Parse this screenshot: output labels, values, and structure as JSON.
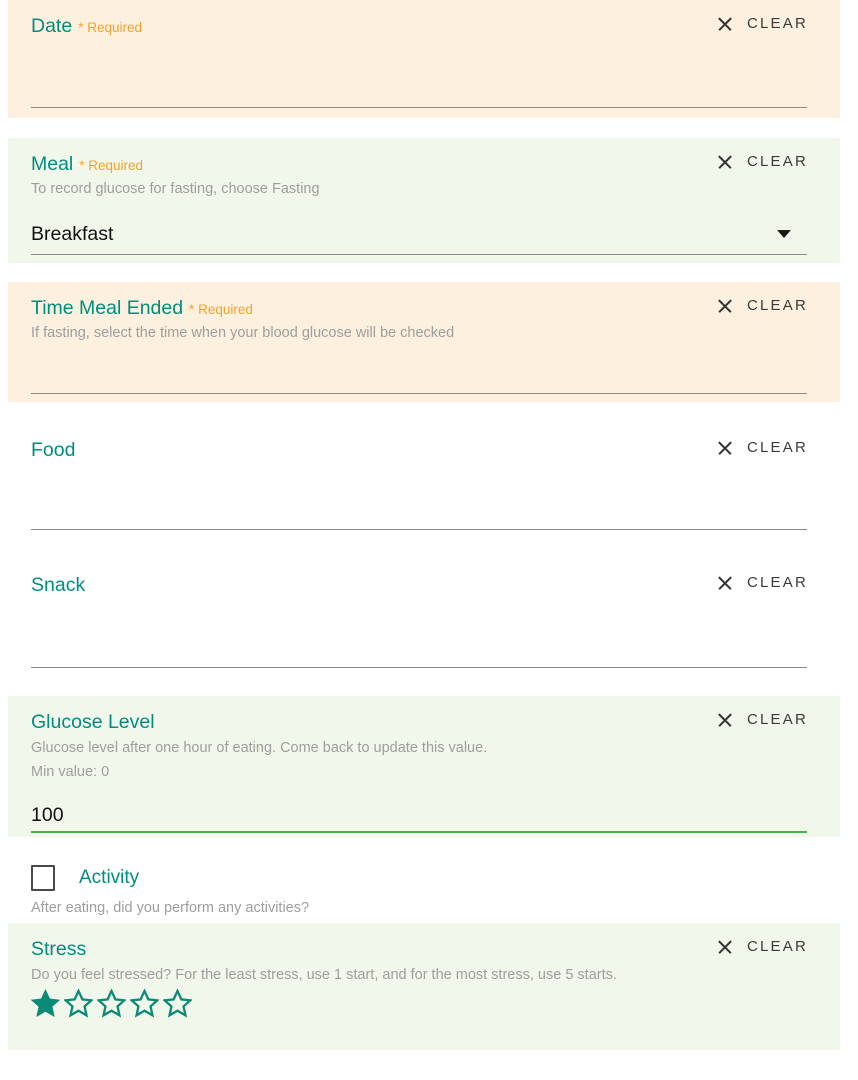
{
  "theme": {
    "label_color": "#008d7f",
    "required_color": "#f0a330",
    "hint_color": "#9e9e9e",
    "bg_orange": "#fdf0de",
    "bg_green": "#f1f7ea",
    "bg_white": "#ffffff",
    "underline_color": "#8a8a8a",
    "underline_valid_color": "#4cae50",
    "value_color": "#111111",
    "star_color": "#0c8a78"
  },
  "common": {
    "clear_label": "CLEAR",
    "clear_icon": "close-icon",
    "required_label": "* Required"
  },
  "fields": [
    {
      "key": "date",
      "label": "Date",
      "required": true,
      "required_label": "* Required",
      "hint": "",
      "value": "",
      "background": "orange",
      "clear_label": "CLEAR",
      "control": "text"
    },
    {
      "key": "meal",
      "label": "Meal",
      "required": true,
      "required_label": "* Required",
      "hint": "To record glucose for fasting, choose Fasting",
      "value": "Breakfast",
      "background": "green",
      "clear_label": "CLEAR",
      "control": "select",
      "caret_icon": "chevron-down-icon"
    },
    {
      "key": "time-meal-ended",
      "label": "Time Meal Ended",
      "required": true,
      "required_label": "* Required",
      "hint": "If fasting, select the time when your blood glucose will be checked",
      "value": "",
      "background": "orange",
      "clear_label": "CLEAR",
      "control": "text"
    },
    {
      "key": "food",
      "label": "Food",
      "required": false,
      "required_label": "",
      "hint": "",
      "value": "",
      "background": "white",
      "clear_label": "CLEAR",
      "control": "text"
    },
    {
      "key": "snack",
      "label": "Snack",
      "required": false,
      "required_label": "",
      "hint": "",
      "value": "",
      "background": "white",
      "clear_label": "CLEAR",
      "control": "text"
    },
    {
      "key": "glucose-level",
      "label": "Glucose Level",
      "required": false,
      "required_label": "",
      "hint": "Glucose level after one hour of eating. Come back to update this value.",
      "hint2": "Min value: 0",
      "value": "100",
      "background": "green",
      "clear_label": "CLEAR",
      "control": "number",
      "underline_state": "valid"
    },
    {
      "key": "activity",
      "label": "Activity",
      "required": false,
      "required_label": "",
      "hint": "After eating, did you perform any activities?",
      "value": "",
      "background": "white",
      "control": "checkbox",
      "checked": false
    },
    {
      "key": "stress",
      "label": "Stress",
      "required": false,
      "required_label": "",
      "hint": "Do you feel stressed? For the least stress, use 1 start, and for the most stress, use 5 starts.",
      "value": 1,
      "max": 5,
      "background": "green",
      "clear_label": "CLEAR",
      "control": "rating"
    }
  ]
}
